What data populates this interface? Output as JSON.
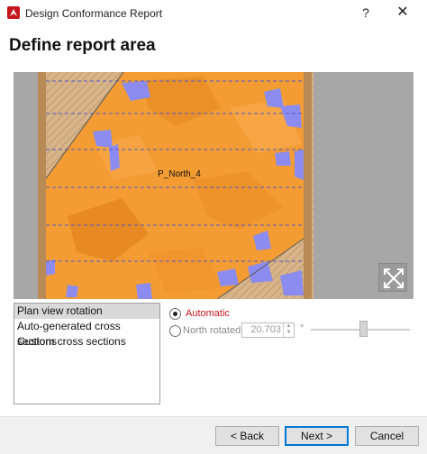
{
  "window": {
    "title": "Design Conformance Report",
    "help_label": "?",
    "close_label": "✕"
  },
  "page": {
    "title": "Define report area"
  },
  "map": {
    "surface_label": "P_North_4"
  },
  "modes": {
    "items": [
      {
        "label": "Plan view rotation",
        "selected": true
      },
      {
        "label": "Auto-generated cross sections",
        "selected": false
      },
      {
        "label": "Custom cross sections",
        "selected": false
      }
    ]
  },
  "rotation": {
    "automatic_label": "Automatic",
    "north_rotated_label": "North rotated",
    "value": "20.703",
    "unit": "°",
    "selected": "automatic"
  },
  "buttons": {
    "back": "< Back",
    "next": "Next >",
    "cancel": "Cancel"
  },
  "colors": {
    "accent_red": "#c4161c",
    "surface_orange": "#f39c33",
    "water_blue": "#8c8cf0",
    "background_gray": "#a7a7a7"
  }
}
